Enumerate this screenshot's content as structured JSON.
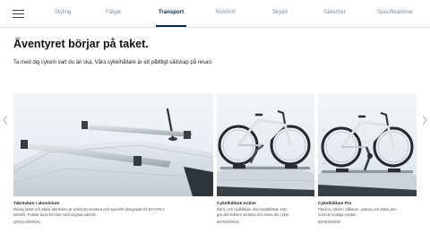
{
  "nav": {
    "tabs": [
      {
        "label": "Styling"
      },
      {
        "label": "Fälgar"
      },
      {
        "label": "Transport"
      },
      {
        "label": "Komfort"
      },
      {
        "label": "Skydd"
      },
      {
        "label": "Säkerhet"
      },
      {
        "label": "Specifikationer"
      }
    ],
    "active_tab": "Transport"
  },
  "page": {
    "title": "Äventyret börjar på taket.",
    "intro": "Ta med dig cykeln vart du än ska. Våra cykelhållare är ett pålitligt sällskap på resan."
  },
  "products": [
    {
      "title": "Takräcken i aluminium",
      "desc_lines": [
        "Dessa fäste och säkra takräcken är enkla att montera och speciellt designade för BAYON:s",
        "takreils. Passar bara för bilar med original takreils."
      ],
      "code": "Q0211ADE00AL"
    },
    {
      "title": "Cykelhållare Active",
      "desc_lines": [
        "Ram- och hjulhållare med snabbfäste som",
        "gör det enkelre att lasta och lossa din cykel."
      ],
      "code": "55700ADE10"
    },
    {
      "title": "Cykelhållare Pro",
      "desc_lines": [
        "Placera cykeln i hållaren, justera och säkra den",
        "med de vridliga vreden."
      ],
      "code": "55700ADE00"
    }
  ],
  "icons": {
    "menu": "hamburger-menu-icon",
    "prev": "chevron-left-icon",
    "next": "chevron-right-icon"
  },
  "colors": {
    "active_tab": "#0a2847",
    "inactive_tab": "#7c8a9a",
    "bar_silver": "#c9ced3",
    "car_body": "#d8dde2"
  }
}
